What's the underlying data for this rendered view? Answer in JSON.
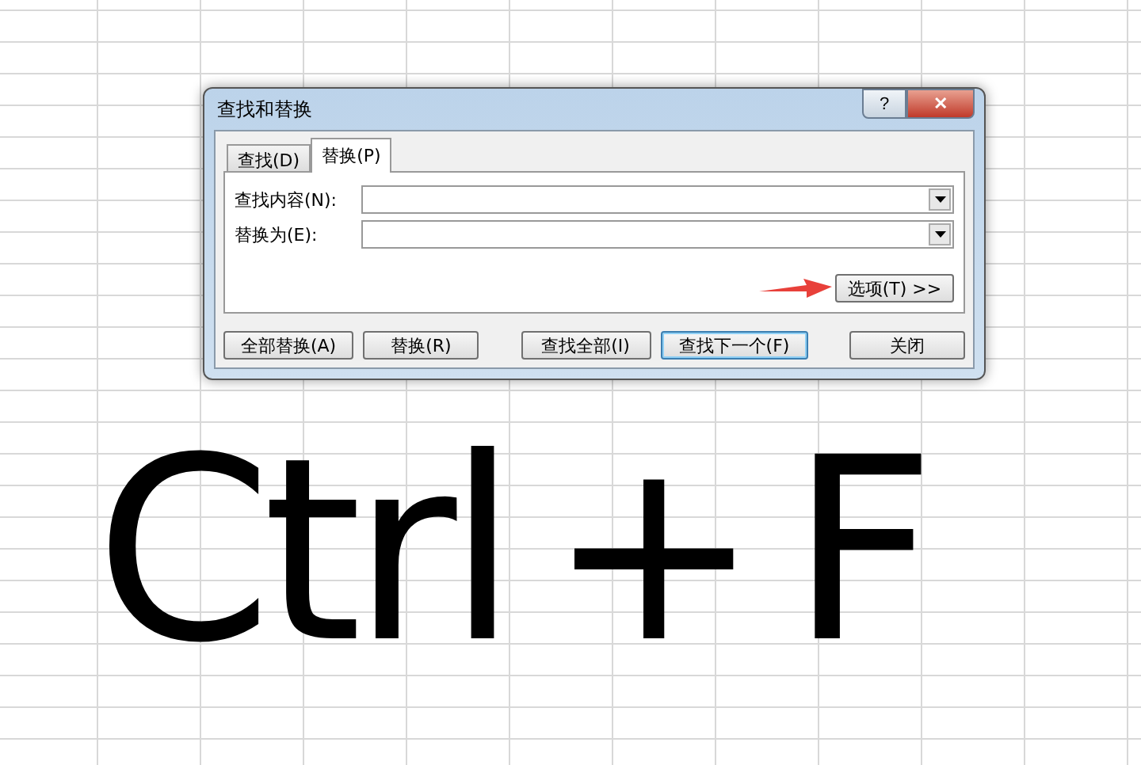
{
  "dialog": {
    "title": "查找和替换",
    "help": "?",
    "close": "✕",
    "tabs": [
      {
        "label": "查找(D)",
        "selected": false
      },
      {
        "label": "替换(P)",
        "selected": true
      }
    ],
    "fields": [
      {
        "label": "查找内容(N):"
      },
      {
        "label": "替换为(E):"
      }
    ],
    "options_button": "选项(T) >>",
    "buttons": [
      {
        "label": "全部替换(A)",
        "default": false
      },
      {
        "label": "替换(R)",
        "default": false
      },
      {
        "label": "查找全部(I)",
        "default": false
      },
      {
        "label": "查找下一个(F)",
        "default": true
      },
      {
        "label": "关闭",
        "default": false
      }
    ]
  },
  "annotation": "Ctrl + F"
}
